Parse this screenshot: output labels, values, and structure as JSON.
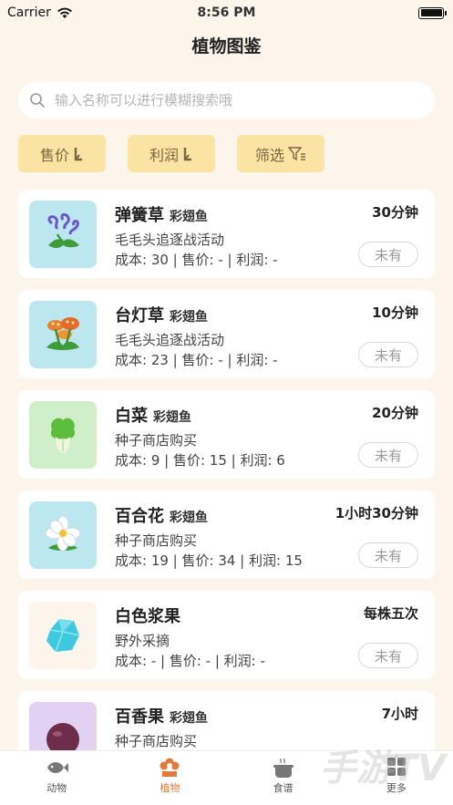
{
  "status_bar": {
    "carrier": "Carrier",
    "time": "8:56 PM"
  },
  "header": {
    "title": "植物图鉴"
  },
  "search": {
    "placeholder": "输入名称可以进行模糊搜索哦"
  },
  "filters": [
    {
      "label": "售价",
      "icon": "sort-desc-icon"
    },
    {
      "label": "利润",
      "icon": "sort-desc-icon"
    },
    {
      "label": "筛选",
      "icon": "filter-icon"
    }
  ],
  "plants": [
    {
      "name": "弹簧草",
      "tag": "彩翅鱼",
      "source": "毛毛头追逐战活动",
      "stats": "成本: 30 | 售价: -  |  利润: -",
      "time": "30分钟",
      "status": "未有",
      "thumb_color": "#BDE7F0",
      "icon": "spring-grass-icon"
    },
    {
      "name": "台灯草",
      "tag": "彩翅鱼",
      "source": "毛毛头追逐战活动",
      "stats": "成本: 23 | 售价: -  |  利润: -",
      "time": "10分钟",
      "status": "未有",
      "thumb_color": "#BDE7F0",
      "icon": "lamp-grass-icon"
    },
    {
      "name": "白菜",
      "tag": "彩翅鱼",
      "source": "种子商店购买",
      "stats": "成本: 9 | 售价: 15  |  利润: 6",
      "time": "20分钟",
      "status": "未有",
      "thumb_color": "#CFEFC8",
      "icon": "cabbage-icon"
    },
    {
      "name": "百合花",
      "tag": "彩翅鱼",
      "source": "种子商店购买",
      "stats": "成本: 19 | 售价: 34  |  利润: 15",
      "time": "1小时30分钟",
      "status": "未有",
      "thumb_color": "#BDE7F0",
      "icon": "lily-icon"
    },
    {
      "name": "白色浆果",
      "tag": "",
      "source": "野外采摘",
      "stats": "成本: - | 售价: -  |  利润: -",
      "time": "每株五次",
      "status": "未有",
      "thumb_color": "#FCF5EC",
      "icon": "white-berry-icon"
    },
    {
      "name": "百香果",
      "tag": "彩翅鱼",
      "source": "种子商店购买",
      "stats": "",
      "time": "7小时",
      "status": "",
      "thumb_color": "#E2D2F2",
      "icon": "passion-fruit-icon"
    }
  ],
  "tabs": [
    {
      "label": "动物",
      "icon": "fish-icon",
      "active": false
    },
    {
      "label": "植物",
      "icon": "flower-icon",
      "active": true
    },
    {
      "label": "食谱",
      "icon": "pot-icon",
      "active": false
    },
    {
      "label": "更多",
      "icon": "grid-icon",
      "active": false
    }
  ],
  "watermark": "手游TV",
  "colors": {
    "accent": "#E07B3B",
    "filter_bg": "#FBE3A4",
    "page_bg": "#FCF5EC"
  }
}
